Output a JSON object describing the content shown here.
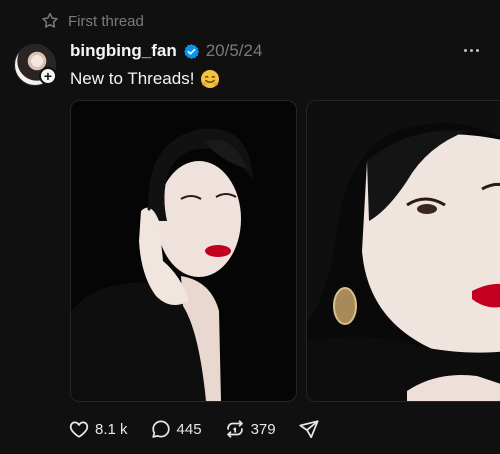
{
  "header_note": {
    "label": "First thread",
    "icon": "star-outline-icon"
  },
  "post": {
    "author": {
      "username": "bingbing_fan",
      "verified": true
    },
    "timestamp": "20/5/24",
    "text": "New to Threads!",
    "emoji": "hugging-face-emoji",
    "images": [
      {
        "alt": ""
      },
      {
        "alt": ""
      }
    ]
  },
  "actions": {
    "like_count": "8.1 k",
    "reply_count": "445",
    "repost_count": "379"
  },
  "colors": {
    "background": "#101010",
    "text_primary": "#f3f5f7",
    "text_secondary": "#7a7a7a",
    "verified_blue": "#0095f6",
    "lipstick_red": "#c3001f"
  }
}
